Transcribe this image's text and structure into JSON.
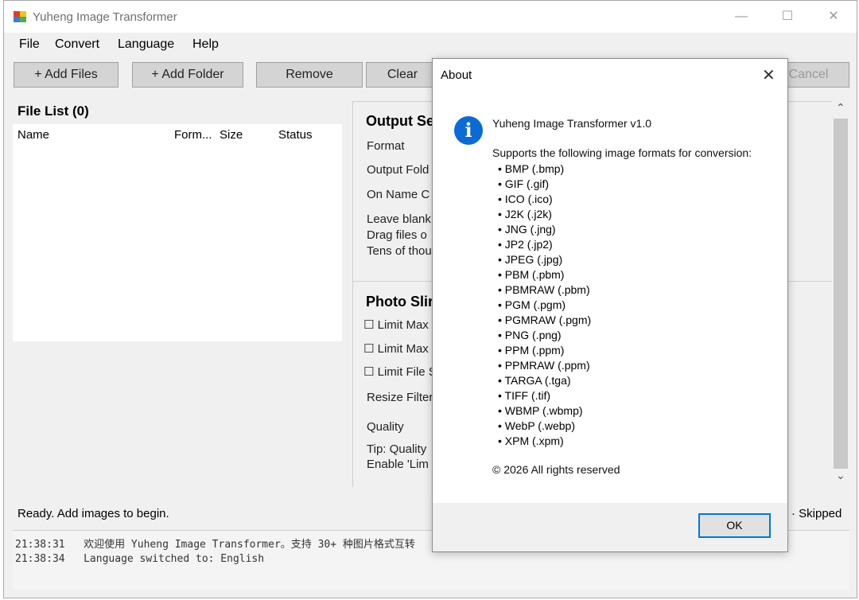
{
  "window": {
    "title": "Yuheng Image Transformer",
    "minimize": "—",
    "maximize": "☐",
    "close": "✕"
  },
  "menu": [
    "File",
    "Convert",
    "Language",
    "Help"
  ],
  "toolbar": {
    "add_files": "+ Add Files",
    "add_folder": "+ Add Folder",
    "remove": "Remove",
    "clear": "Clear",
    "cancel": "Cancel"
  },
  "file_list": {
    "title": "File List (0)",
    "columns": [
      "Name",
      "Form...",
      "Size",
      "Status"
    ]
  },
  "output_settings": {
    "title": "Output Se",
    "format_label": "Format",
    "output_folder_label": "Output Fold",
    "on_name_conflict_label": "On Name C",
    "leave_blank_text": "Leave blank",
    "drag_files_text": "Drag files o",
    "tens_of_text": "Tens of thou"
  },
  "photo_slim": {
    "title": "Photo Slir",
    "limit_max_1": "Limit Max",
    "limit_max_2": "Limit Max",
    "limit_file": "Limit File S",
    "resize_filter_label": "Resize Filter",
    "quality_label": "Quality",
    "tip_text": "Tip: Quality",
    "enable_text": "Enable 'Lim"
  },
  "scroll": {
    "up": "⌃",
    "down": "⌄"
  },
  "status": {
    "text": "Ready. Add images to begin.",
    "right_text": "· Skipped"
  },
  "log": [
    {
      "time": "21:38:31",
      "message": "欢迎使用 Yuheng Image Transformer。支持 30+ 种图片格式互转"
    },
    {
      "time": "21:38:34",
      "message": "Language switched to: English"
    }
  ],
  "about_dialog": {
    "title": "About",
    "close": "✕",
    "icon_glyph": "i",
    "app_version": "Yuheng Image Transformer v1.0",
    "supports_text": "Supports the following image formats for conversion:",
    "formats": [
      "• BMP  (.bmp)",
      "• GIF  (.gif)",
      "• ICO  (.ico)",
      "• J2K  (.j2k)",
      "• JNG  (.jng)",
      "• JP2  (.jp2)",
      "• JPEG  (.jpg)",
      "• PBM  (.pbm)",
      "• PBMRAW  (.pbm)",
      "• PGM  (.pgm)",
      "• PGMRAW  (.pgm)",
      "• PNG  (.png)",
      "• PPM  (.ppm)",
      "• PPMRAW  (.ppm)",
      "• TARGA  (.tga)",
      "• TIFF  (.tif)",
      "• WBMP  (.wbmp)",
      "• WebP  (.webp)",
      "• XPM  (.xpm)"
    ],
    "copyright": "© 2026 All rights reserved",
    "ok_label": "OK"
  },
  "colors": {
    "accent": "#0078d7",
    "info_icon": "#0b6ad4"
  }
}
